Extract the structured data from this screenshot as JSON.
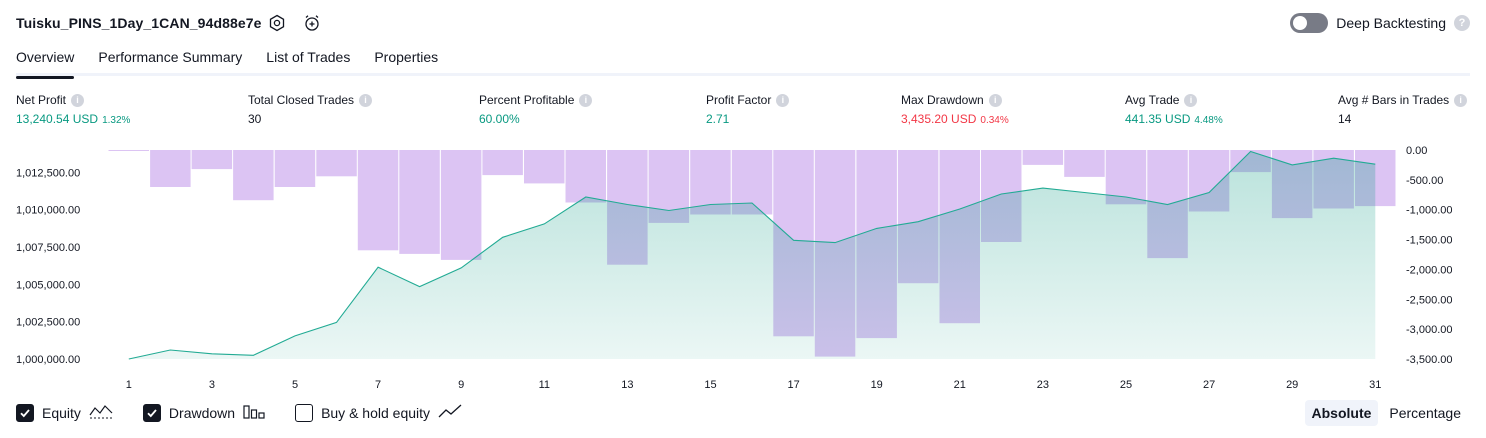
{
  "header": {
    "strategy_name": "Tuisku_PINS_1Day_1CAN_94d88e7e",
    "settings_icon": "gear-icon",
    "alert_icon": "alarm-clock-plus-icon",
    "deep_backtesting_label": "Deep Backtesting",
    "deep_backtesting_enabled": false
  },
  "tabs": [
    {
      "label": "Overview",
      "active": true
    },
    {
      "label": "Performance Summary",
      "active": false
    },
    {
      "label": "List of Trades",
      "active": false
    },
    {
      "label": "Properties",
      "active": false
    }
  ],
  "metrics": [
    {
      "label": "Net Profit",
      "value": "13,240.54 USD",
      "pct": "1.32%",
      "color": "#089981"
    },
    {
      "label": "Total Closed Trades",
      "value": "30",
      "pct": "",
      "color": "#131722"
    },
    {
      "label": "Percent Profitable",
      "value": "60.00%",
      "pct": "",
      "color": "#089981"
    },
    {
      "label": "Profit Factor",
      "value": "2.71",
      "pct": "",
      "color": "#089981"
    },
    {
      "label": "Max Drawdown",
      "value": "3,435.20 USD",
      "pct": "0.34%",
      "color": "#f23645"
    },
    {
      "label": "Avg Trade",
      "value": "441.35 USD",
      "pct": "4.48%",
      "color": "#089981"
    },
    {
      "label": "Avg # Bars in Trades",
      "value": "14",
      "pct": "",
      "color": "#131722"
    }
  ],
  "chart_data": {
    "type": "area",
    "x": [
      1,
      2,
      3,
      4,
      5,
      6,
      7,
      8,
      9,
      10,
      11,
      12,
      13,
      14,
      15,
      16,
      17,
      18,
      19,
      20,
      21,
      22,
      23,
      24,
      25,
      26,
      27,
      28,
      29,
      30,
      31
    ],
    "x_tick_labels": [
      "1",
      "3",
      "5",
      "7",
      "9",
      "11",
      "13",
      "15",
      "17",
      "19",
      "21",
      "23",
      "25",
      "27",
      "29",
      "31"
    ],
    "series": [
      {
        "name": "Equity",
        "axis": "left",
        "color": "#089981",
        "values": [
          1000000,
          1000600,
          1000350,
          1000250,
          1001550,
          1002450,
          1006150,
          1004850,
          1006100,
          1008150,
          1009050,
          1010850,
          1010350,
          1009950,
          1010350,
          1010450,
          1007950,
          1007800,
          1008750,
          1009200,
          1010050,
          1011050,
          1011450,
          1011150,
          1010850,
          1010350,
          1011150,
          1013900,
          1013000,
          1013450,
          1013050
        ]
      },
      {
        "name": "Drawdown",
        "axis": "right",
        "color": "#ce93d8",
        "values": [
          0,
          -620,
          -320,
          -840,
          -620,
          -440,
          -1680,
          -1740,
          -1840,
          -420,
          -560,
          -880,
          -1920,
          -1220,
          -1080,
          -1080,
          -3120,
          -3460,
          -3150,
          -2230,
          -2900,
          -1540,
          -250,
          -450,
          -910,
          -1810,
          -1030,
          -370,
          -1140,
          -980,
          -940
        ]
      }
    ],
    "y_left": {
      "ticks": [
        "1,000,000.00",
        "1,002,500.00",
        "1,005,000.00",
        "1,007,500.00",
        "1,010,000.00",
        "1,012,500.00"
      ],
      "range": [
        1000000,
        1014000
      ]
    },
    "y_right": {
      "ticks": [
        "0.00",
        "-500.00",
        "-1,000.00",
        "-1,500.00",
        "-2,000.00",
        "-2,500.00",
        "-3,000.00",
        "-3,500.00"
      ],
      "range": [
        -3500,
        0
      ]
    }
  },
  "legend": [
    {
      "label": "Equity",
      "checked": true,
      "icon": "equity-area-icon"
    },
    {
      "label": "Drawdown",
      "checked": true,
      "icon": "drawdown-bars-icon"
    },
    {
      "label": "Buy & hold equity",
      "checked": false,
      "icon": "buy-hold-line-icon"
    }
  ],
  "view_modes": [
    {
      "label": "Absolute",
      "active": true
    },
    {
      "label": "Percentage",
      "active": false
    }
  ]
}
